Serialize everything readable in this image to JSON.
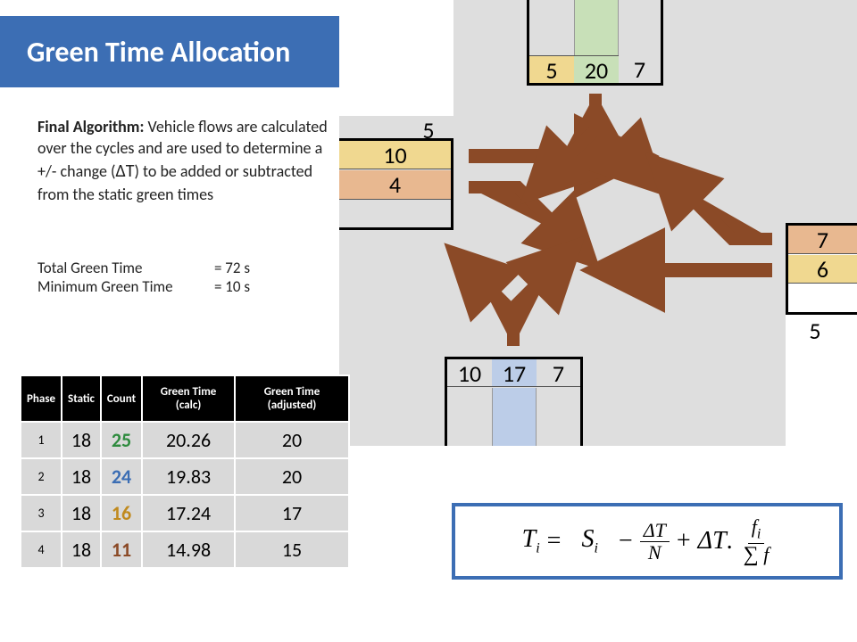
{
  "title": "Green Time Allocation",
  "algorithm": {
    "heading": "Final Algorithm:",
    "body_prefix": "Vehicle flows are calculated over the cycles and are used to determine a +/- change (",
    "delta_t": "ΔT",
    "body_suffix": ") to be added  or subtracted from the static green times"
  },
  "summary": {
    "total_label": "Total Green Time",
    "total_value": "= 72 s",
    "min_label": "Minimum Green Time",
    "min_value": "= 10 s"
  },
  "lanes": {
    "north": {
      "left": "5",
      "mid": "20",
      "right": "7"
    },
    "west": {
      "top": "5",
      "mid": "10",
      "bot": "4"
    },
    "east": {
      "top": "7",
      "mid": "6",
      "bot": "5"
    },
    "south": {
      "left": "10",
      "mid": "17",
      "right": "7"
    }
  },
  "table": {
    "headers": {
      "phase": "Phase",
      "static_": "Static",
      "count": "Count",
      "calc": "Green Time (calc)",
      "adjusted": "Green Time (adjusted)"
    },
    "rows": [
      {
        "phase": "1",
        "static_": "18",
        "count": "25",
        "calc": "20.26",
        "adjusted": "20"
      },
      {
        "phase": "2",
        "static_": "18",
        "count": "24",
        "calc": "19.83",
        "adjusted": "20"
      },
      {
        "phase": "3",
        "static_": "18",
        "count": "16",
        "calc": "17.24",
        "adjusted": "17"
      },
      {
        "phase": "4",
        "static_": "18",
        "count": "11",
        "calc": "14.98",
        "adjusted": "15"
      }
    ]
  },
  "equation": {
    "T": "T",
    "i": "i",
    "eq": "=",
    "S": "S",
    "minus": "−",
    "plus": "+",
    "DT": "ΔT",
    "N": "N",
    "dot": ".",
    "f": "f",
    "sum": "∑"
  }
}
